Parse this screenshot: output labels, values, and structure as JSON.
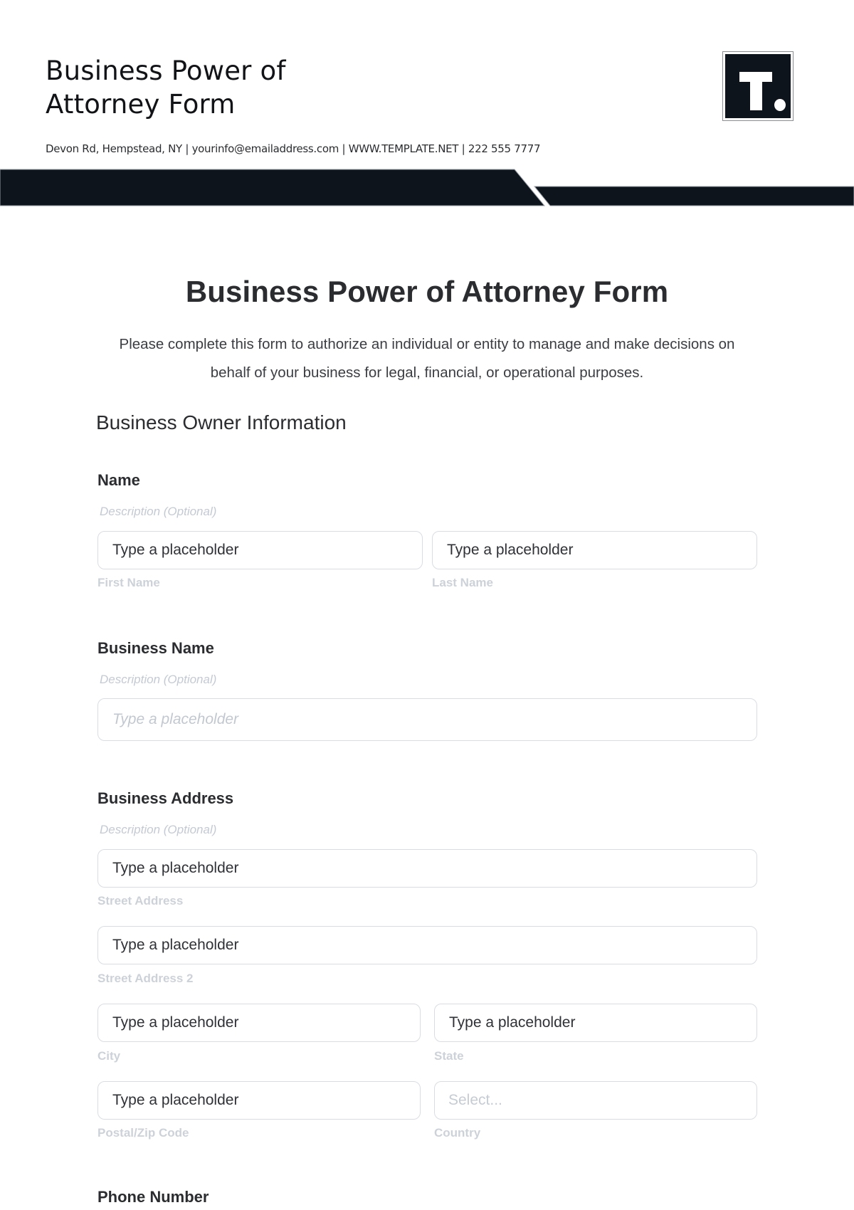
{
  "header": {
    "title_line1": "Business Power of",
    "title_line2": "Attorney Form",
    "contact": "Devon Rd, Hempstead, NY | yourinfo@emailaddress.com | WWW.TEMPLATE.NET | 222 555 7777",
    "logo_letter": "T."
  },
  "colors": {
    "band": "#0d141c",
    "logo_bg": "#0d141c",
    "input_border": "#d9dde3",
    "muted_text": "#c4cad3"
  },
  "form": {
    "title": "Business Power of Attorney Form",
    "intro": "Please complete this form to authorize an individual or entity to manage and make decisions on behalf of your business for legal, financial, or operational purposes.",
    "section_title": "Business Owner Information",
    "fields": {
      "name": {
        "label": "Name",
        "description": "Description (Optional)",
        "first": {
          "value": "Type a placeholder",
          "sublabel": "First Name"
        },
        "last": {
          "value": "Type a placeholder",
          "sublabel": "Last Name"
        }
      },
      "business_name": {
        "label": "Business Name",
        "description": "Description (Optional)",
        "placeholder": "Type a placeholder"
      },
      "business_address": {
        "label": "Business Address",
        "description": "Description (Optional)",
        "street": {
          "value": "Type a placeholder",
          "sublabel": "Street Address"
        },
        "street2": {
          "value": "Type a placeholder",
          "sublabel": "Street Address 2"
        },
        "city": {
          "value": "Type a placeholder",
          "sublabel": "City"
        },
        "state": {
          "value": "Type a placeholder",
          "sublabel": "State"
        },
        "zip": {
          "value": "Type a placeholder",
          "sublabel": "Postal/Zip Code"
        },
        "country": {
          "placeholder": "Select...",
          "sublabel": "Country"
        }
      },
      "phone": {
        "label": "Phone Number"
      }
    }
  }
}
